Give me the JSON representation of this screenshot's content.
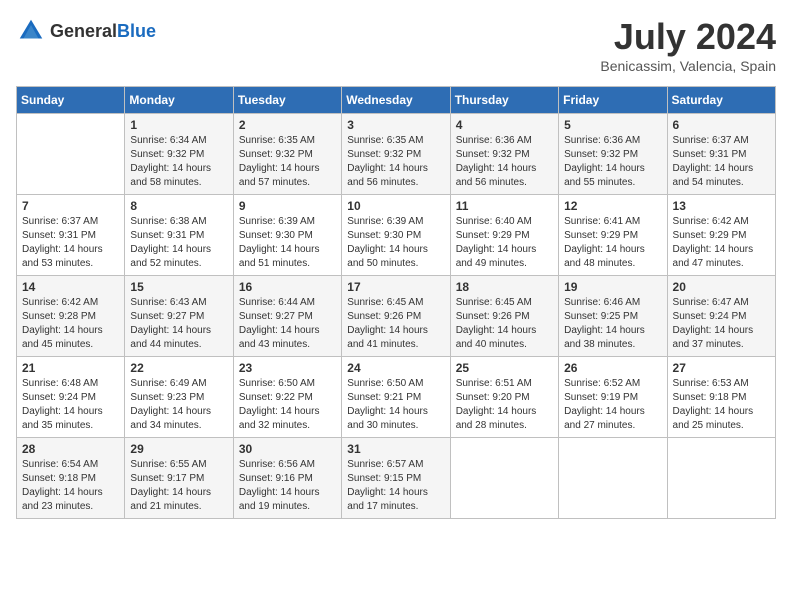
{
  "header": {
    "logo_general": "General",
    "logo_blue": "Blue",
    "month_year": "July 2024",
    "location": "Benicassim, Valencia, Spain"
  },
  "weekdays": [
    "Sunday",
    "Monday",
    "Tuesday",
    "Wednesday",
    "Thursday",
    "Friday",
    "Saturday"
  ],
  "weeks": [
    [
      {
        "day": "",
        "info": ""
      },
      {
        "day": "1",
        "info": "Sunrise: 6:34 AM\nSunset: 9:32 PM\nDaylight: 14 hours\nand 58 minutes."
      },
      {
        "day": "2",
        "info": "Sunrise: 6:35 AM\nSunset: 9:32 PM\nDaylight: 14 hours\nand 57 minutes."
      },
      {
        "day": "3",
        "info": "Sunrise: 6:35 AM\nSunset: 9:32 PM\nDaylight: 14 hours\nand 56 minutes."
      },
      {
        "day": "4",
        "info": "Sunrise: 6:36 AM\nSunset: 9:32 PM\nDaylight: 14 hours\nand 56 minutes."
      },
      {
        "day": "5",
        "info": "Sunrise: 6:36 AM\nSunset: 9:32 PM\nDaylight: 14 hours\nand 55 minutes."
      },
      {
        "day": "6",
        "info": "Sunrise: 6:37 AM\nSunset: 9:31 PM\nDaylight: 14 hours\nand 54 minutes."
      }
    ],
    [
      {
        "day": "7",
        "info": "Sunrise: 6:37 AM\nSunset: 9:31 PM\nDaylight: 14 hours\nand 53 minutes."
      },
      {
        "day": "8",
        "info": "Sunrise: 6:38 AM\nSunset: 9:31 PM\nDaylight: 14 hours\nand 52 minutes."
      },
      {
        "day": "9",
        "info": "Sunrise: 6:39 AM\nSunset: 9:30 PM\nDaylight: 14 hours\nand 51 minutes."
      },
      {
        "day": "10",
        "info": "Sunrise: 6:39 AM\nSunset: 9:30 PM\nDaylight: 14 hours\nand 50 minutes."
      },
      {
        "day": "11",
        "info": "Sunrise: 6:40 AM\nSunset: 9:29 PM\nDaylight: 14 hours\nand 49 minutes."
      },
      {
        "day": "12",
        "info": "Sunrise: 6:41 AM\nSunset: 9:29 PM\nDaylight: 14 hours\nand 48 minutes."
      },
      {
        "day": "13",
        "info": "Sunrise: 6:42 AM\nSunset: 9:29 PM\nDaylight: 14 hours\nand 47 minutes."
      }
    ],
    [
      {
        "day": "14",
        "info": "Sunrise: 6:42 AM\nSunset: 9:28 PM\nDaylight: 14 hours\nand 45 minutes."
      },
      {
        "day": "15",
        "info": "Sunrise: 6:43 AM\nSunset: 9:27 PM\nDaylight: 14 hours\nand 44 minutes."
      },
      {
        "day": "16",
        "info": "Sunrise: 6:44 AM\nSunset: 9:27 PM\nDaylight: 14 hours\nand 43 minutes."
      },
      {
        "day": "17",
        "info": "Sunrise: 6:45 AM\nSunset: 9:26 PM\nDaylight: 14 hours\nand 41 minutes."
      },
      {
        "day": "18",
        "info": "Sunrise: 6:45 AM\nSunset: 9:26 PM\nDaylight: 14 hours\nand 40 minutes."
      },
      {
        "day": "19",
        "info": "Sunrise: 6:46 AM\nSunset: 9:25 PM\nDaylight: 14 hours\nand 38 minutes."
      },
      {
        "day": "20",
        "info": "Sunrise: 6:47 AM\nSunset: 9:24 PM\nDaylight: 14 hours\nand 37 minutes."
      }
    ],
    [
      {
        "day": "21",
        "info": "Sunrise: 6:48 AM\nSunset: 9:24 PM\nDaylight: 14 hours\nand 35 minutes."
      },
      {
        "day": "22",
        "info": "Sunrise: 6:49 AM\nSunset: 9:23 PM\nDaylight: 14 hours\nand 34 minutes."
      },
      {
        "day": "23",
        "info": "Sunrise: 6:50 AM\nSunset: 9:22 PM\nDaylight: 14 hours\nand 32 minutes."
      },
      {
        "day": "24",
        "info": "Sunrise: 6:50 AM\nSunset: 9:21 PM\nDaylight: 14 hours\nand 30 minutes."
      },
      {
        "day": "25",
        "info": "Sunrise: 6:51 AM\nSunset: 9:20 PM\nDaylight: 14 hours\nand 28 minutes."
      },
      {
        "day": "26",
        "info": "Sunrise: 6:52 AM\nSunset: 9:19 PM\nDaylight: 14 hours\nand 27 minutes."
      },
      {
        "day": "27",
        "info": "Sunrise: 6:53 AM\nSunset: 9:18 PM\nDaylight: 14 hours\nand 25 minutes."
      }
    ],
    [
      {
        "day": "28",
        "info": "Sunrise: 6:54 AM\nSunset: 9:18 PM\nDaylight: 14 hours\nand 23 minutes."
      },
      {
        "day": "29",
        "info": "Sunrise: 6:55 AM\nSunset: 9:17 PM\nDaylight: 14 hours\nand 21 minutes."
      },
      {
        "day": "30",
        "info": "Sunrise: 6:56 AM\nSunset: 9:16 PM\nDaylight: 14 hours\nand 19 minutes."
      },
      {
        "day": "31",
        "info": "Sunrise: 6:57 AM\nSunset: 9:15 PM\nDaylight: 14 hours\nand 17 minutes."
      },
      {
        "day": "",
        "info": ""
      },
      {
        "day": "",
        "info": ""
      },
      {
        "day": "",
        "info": ""
      }
    ]
  ]
}
